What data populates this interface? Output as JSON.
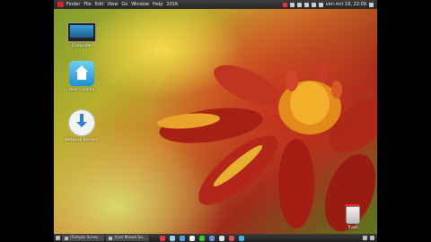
{
  "top_panel": {
    "menus": [
      "Finder",
      "File",
      "Edit",
      "View",
      "Go",
      "Window",
      "Help",
      "2016"
    ],
    "clock": "ven mrt 16, 22:09"
  },
  "desktop": {
    "icons": [
      {
        "label": "Computer"
      },
      {
        "label": "User's Home"
      },
      {
        "label": "Network Servers"
      },
      {
        "label": "Trash"
      }
    ]
  },
  "taskbar": {
    "tasks": [
      {
        "label": "[Simple Scree..."
      },
      {
        "label": "[Get Mixed So..."
      }
    ],
    "dock_colors": [
      "#e33b3b",
      "#9bd1f0",
      "#5aa0e0",
      "#f0f0f0",
      "#3cc43c",
      "#6a8fe0",
      "#e0e0e0",
      "#e05050",
      "#4ab0e0"
    ]
  }
}
